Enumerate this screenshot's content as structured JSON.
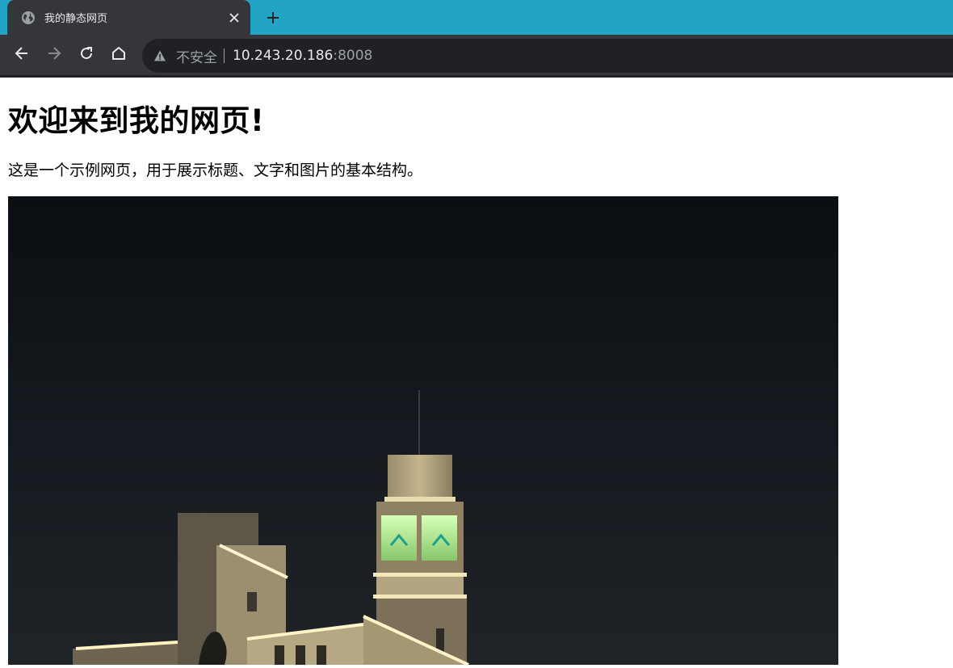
{
  "browser": {
    "tab": {
      "title": "我的静态网页",
      "favicon": "globe-icon",
      "close_icon": "close-icon"
    },
    "new_tab_icon": "plus-icon",
    "nav": {
      "back_icon": "arrow-left-icon",
      "forward_icon": "arrow-right-icon",
      "reload_icon": "reload-icon",
      "home_icon": "home-icon"
    },
    "address_bar": {
      "security_icon": "warning-icon",
      "security_label": "不安全",
      "host": "10.243.20.186",
      "port": ":8008"
    },
    "colors": {
      "tabstrip": "#22a5c5",
      "chrome": "#35363a",
      "omnibox": "#202124"
    }
  },
  "page": {
    "title": "欢迎来到我的网页!",
    "description": "这是一个示例网页，用于展示标题、文字和图片的基本结构。",
    "image": "night-photo-of-clock-tower-building"
  }
}
